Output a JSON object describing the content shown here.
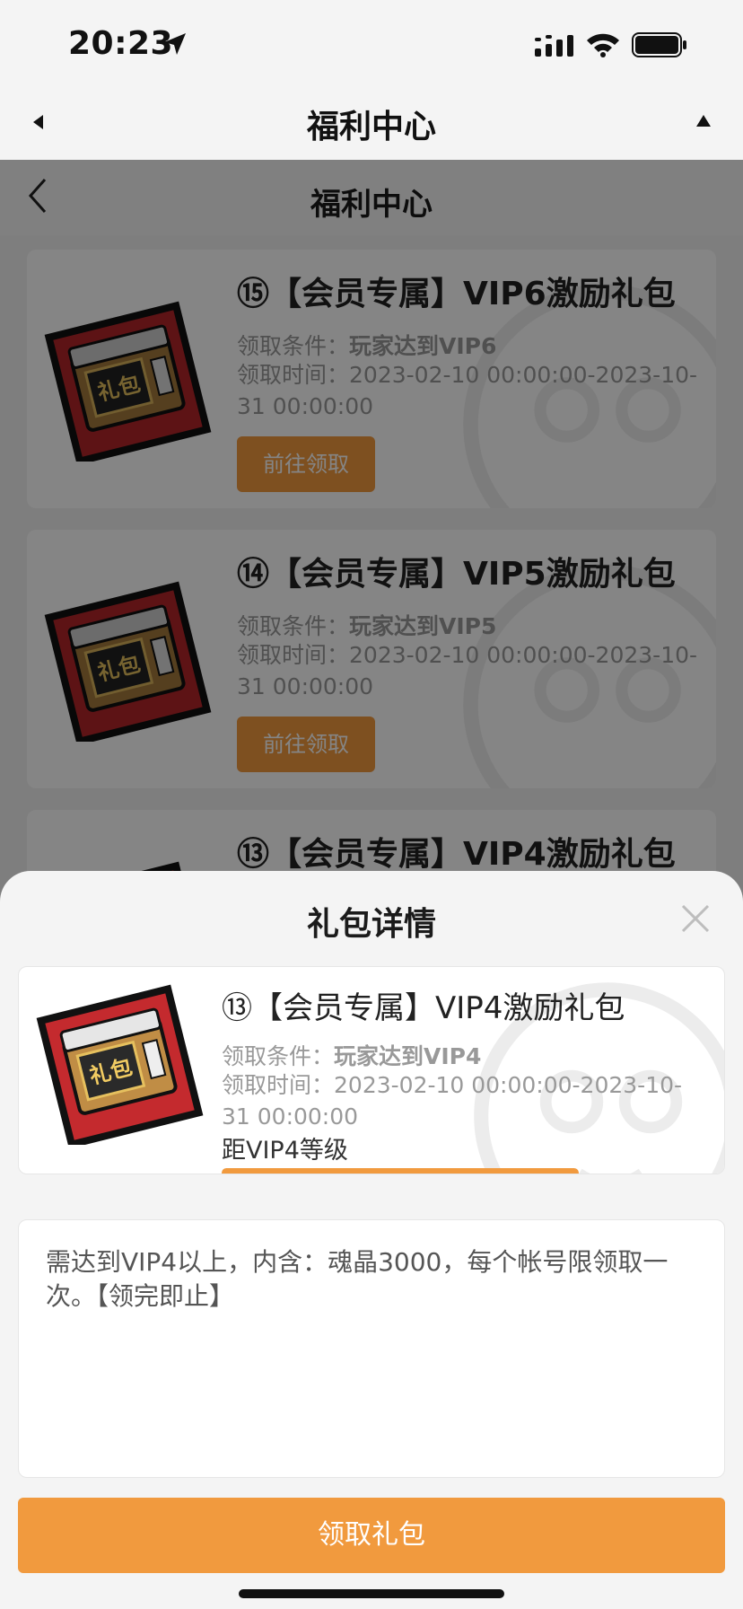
{
  "status_bar": {
    "time": "20:23"
  },
  "outer_nav": {
    "title": "福利中心"
  },
  "inner_nav": {
    "title": "福利中心"
  },
  "cards": [
    {
      "title": "⑮【会员专属】VIP6激励礼包",
      "cond_label": "领取条件：",
      "cond_value": "玩家达到VIP6",
      "time_label": "领取时间：",
      "time_value": "2023-02-10 00:00:00-2023-10-31 00:00:00",
      "button": "前往领取"
    },
    {
      "title": "⑭【会员专属】VIP5激励礼包",
      "cond_label": "领取条件：",
      "cond_value": "玩家达到VIP5",
      "time_label": "领取时间：",
      "time_value": "2023-02-10 00:00:00-2023-10-31 00:00:00",
      "button": "前往领取"
    },
    {
      "title": "⑬【会员专属】VIP4激励礼包"
    }
  ],
  "gift_icon_text": "礼包",
  "sheet": {
    "title": "礼包详情",
    "detail": {
      "title": "⑬【会员专属】VIP4激励礼包",
      "cond_label": "领取条件：",
      "cond_value": "玩家达到VIP4",
      "time_label": "领取时间：",
      "time_value": "2023-02-10 00:00:00-2023-10-31 00:00:00",
      "level_text": "距VIP4等级",
      "progress": 1.0
    },
    "description": "需达到VIP4以上，内含：魂晶3000，每个帐号限领取一次。【领完即止】",
    "claim_button": "领取礼包"
  },
  "colors": {
    "accent": "#f19a3e"
  }
}
